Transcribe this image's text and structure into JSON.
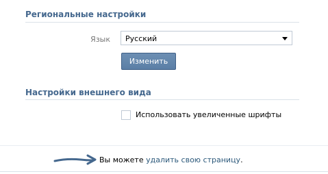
{
  "regional": {
    "title": "Региональные настройки",
    "language_label": "Язык",
    "language_value": "Русский",
    "change_button": "Изменить"
  },
  "appearance": {
    "title": "Настройки внешнего вида",
    "large_fonts_label": "Использовать увеличенные шрифты",
    "large_fonts_checked": false
  },
  "footer": {
    "prefix": "Вы можете ",
    "delete_link": "удалить свою страницу",
    "suffix": "."
  },
  "colors": {
    "section_title": "#45688e",
    "link": "#2b587a",
    "button": "#5b7fa6",
    "divider": "#dae1e8"
  },
  "icons": {
    "pointer_arrow": "arrow-right-icon",
    "dropdown": "chevron-down-icon"
  }
}
